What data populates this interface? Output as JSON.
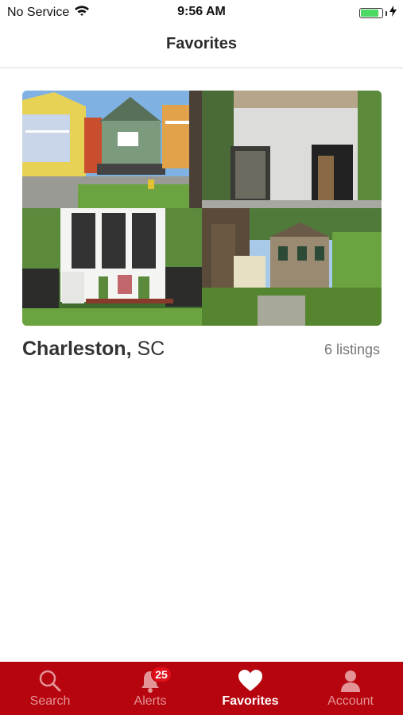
{
  "status_bar": {
    "carrier": "No Service",
    "time": "9:56 AM",
    "wifi_icon": "wifi-icon",
    "battery_icon": "battery-icon",
    "charging_icon": "charging-bolt-icon",
    "battery_color": "#4cd964"
  },
  "nav": {
    "title": "Favorites"
  },
  "favorite_group": {
    "city": "Charleston,",
    "state": "SC",
    "count": "6 listings",
    "photos": [
      {
        "icon": "house-photo-icon",
        "description_name": "photo-colorful-houses"
      },
      {
        "icon": "house-photo-icon",
        "description_name": "photo-modern-white-house"
      },
      {
        "icon": "house-photo-icon",
        "description_name": "photo-white-porch-house"
      },
      {
        "icon": "house-photo-icon",
        "description_name": "photo-brick-house-oak-tree"
      }
    ]
  },
  "tab_bar": {
    "background": "#b6050e",
    "tabs": [
      {
        "label": "Search",
        "icon": "search-icon",
        "active": false
      },
      {
        "label": "Alerts",
        "icon": "bell-icon",
        "active": false,
        "badge": "25"
      },
      {
        "label": "Favorites",
        "icon": "heart-icon",
        "active": true
      },
      {
        "label": "Account",
        "icon": "person-icon",
        "active": false
      }
    ]
  }
}
